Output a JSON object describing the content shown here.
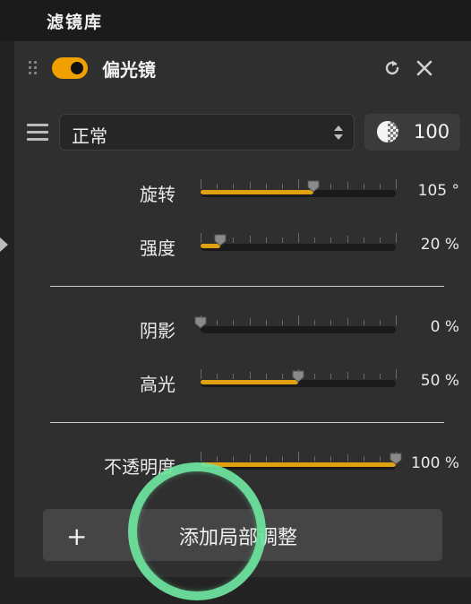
{
  "header": {
    "title": "滤镜库"
  },
  "filter": {
    "enabled": true,
    "name": "偏光镜",
    "reset_icon": "reset-icon",
    "close_icon": "close-icon"
  },
  "blend": {
    "mode": "正常",
    "opacity": "100"
  },
  "sliders": [
    {
      "key": "rotate",
      "label": "旋转",
      "value": "105 °",
      "level": 0.58
    },
    {
      "key": "strength",
      "label": "强度",
      "value": "20 %",
      "level": 0.1
    },
    {
      "key": "shadow",
      "label": "阴影",
      "value": "0 %",
      "level": 0.0
    },
    {
      "key": "highlight",
      "label": "高光",
      "value": "50 %",
      "level": 0.5
    },
    {
      "key": "opacity",
      "label": "不透明度",
      "value": "100 %",
      "level": 1.0
    }
  ],
  "add_local": {
    "plus": "+",
    "label": "添加局部调整"
  },
  "colors": {
    "accent": "#f0a000",
    "fill": "#e0a010",
    "cursor_ring": "#6ee6a0"
  }
}
